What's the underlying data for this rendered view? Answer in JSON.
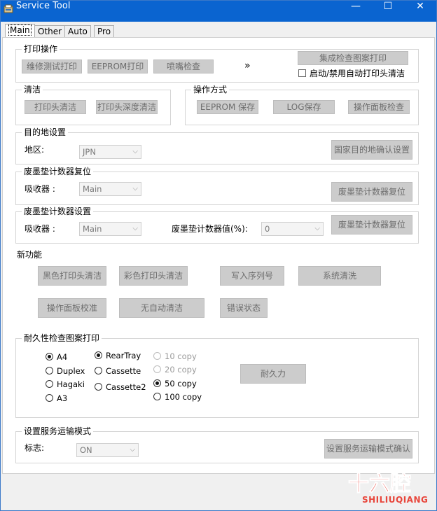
{
  "window": {
    "title": "Service Tool",
    "controls": {
      "minimize": "—",
      "maximize": "☐",
      "close": "✕"
    }
  },
  "tabs": [
    {
      "label": "Main",
      "active": true
    },
    {
      "label": "Other"
    },
    {
      "label": "Auto"
    },
    {
      "label": "Pro"
    }
  ],
  "print_ops": {
    "title": "打印操作",
    "buttons": [
      "维修测试打印",
      "EEPROM打印",
      "喷嘴检查"
    ],
    "more": "»",
    "integrated_button": "集成检查图案打印",
    "checkbox_label": "启动/禁用自动打印头清洁"
  },
  "cleaning": {
    "title": "清洁",
    "buttons": [
      "打印头清洁",
      "打印头深度清洁"
    ]
  },
  "operation_mode": {
    "title": "操作方式",
    "buttons": [
      "EEPROM 保存",
      "LOG保存",
      "操作面板检查"
    ]
  },
  "destination": {
    "title": "目的地设置",
    "region_label": "地区:",
    "region_value": "JPN",
    "confirm_button": "国家目的地确认设置"
  },
  "waste_reset": {
    "title": "废墨垫计数器复位",
    "absorber_label": "吸收器 :",
    "absorber_value": "Main",
    "button": "废墨垫计数器复位"
  },
  "waste_set": {
    "title": "废墨垫计数器设置",
    "absorber_label": "吸收器 :",
    "absorber_value": "Main",
    "counter_label": "废墨垫计数器值(%):",
    "counter_value": "0",
    "button": "废墨垫计数器复位"
  },
  "new_functions": {
    "title": "新功能",
    "row1": [
      "黑色打印头清洁",
      "彩色打印头清洁",
      "写入序列号",
      "系统清洗"
    ],
    "row2": [
      "操作面板校准",
      "无自动清洁",
      "错误状态"
    ]
  },
  "durability": {
    "title": "耐久性检查图案打印",
    "paper": [
      "A4",
      "Duplex",
      "Hagaki",
      "A3"
    ],
    "paper_selected": "A4",
    "feed": [
      "RearTray",
      "Cassette",
      "Cassette2"
    ],
    "feed_selected": "RearTray",
    "copies": [
      "10 copy",
      "20 copy",
      "50 copy",
      "100 copy"
    ],
    "copies_selected": "50 copy",
    "button": "耐久力"
  },
  "transport": {
    "title": "设置服务运输模式",
    "flag_label": "标志:",
    "flag_value": "ON",
    "button": "设置服务运输模式确认"
  },
  "watermark": {
    "cn": "十六腔",
    "en": "SHILIUQIANG"
  },
  "colors": {
    "titlebar": "#0a64d0",
    "watermark": "#e8453a",
    "disabled_button": "#cccccc"
  }
}
